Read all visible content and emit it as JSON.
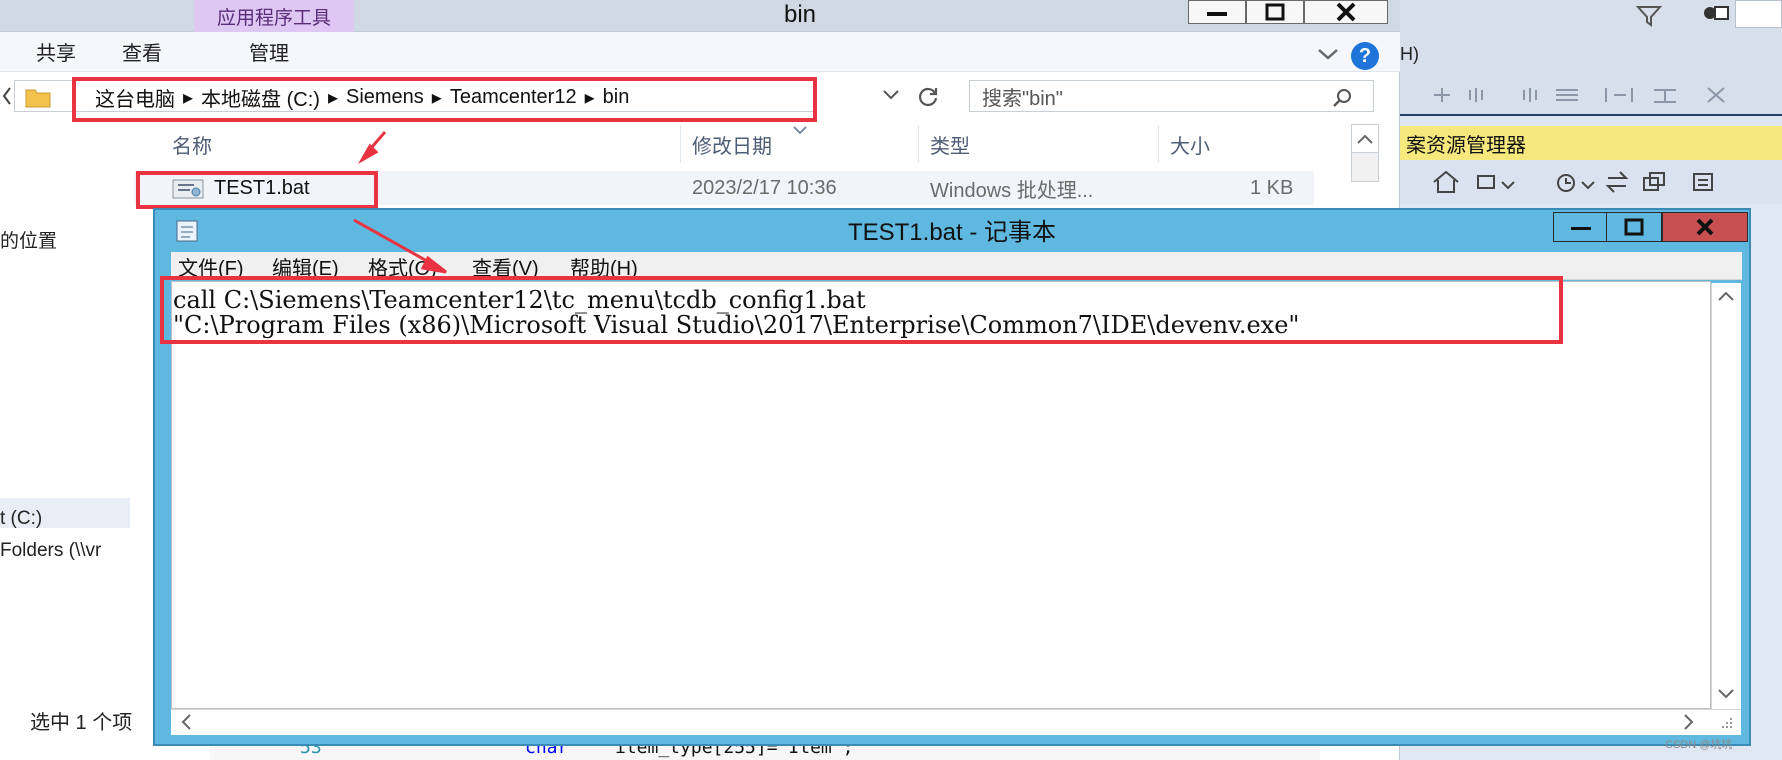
{
  "explorer": {
    "title": "bin",
    "context_tab": "应用程序工具",
    "menu": [
      "共享",
      "查看",
      "管理"
    ],
    "breadcrumb": [
      "这台电脑",
      "本地磁盘 (C:)",
      "Siemens",
      "Teamcenter12",
      "bin"
    ],
    "search_placeholder": "搜索\"bin\"",
    "columns": [
      "名称",
      "修改日期",
      "类型",
      "大小"
    ],
    "file": {
      "name": "TEST1.bat",
      "date": "2023/2/17 10:36",
      "type": "Windows 批处理...",
      "size": "1 KB"
    },
    "left_nav": [
      "的位置",
      "t (C:)",
      "Folders (\\\\vr"
    ],
    "status": "选中 1 个项"
  },
  "ide": {
    "menu_fragment": "H)",
    "panel_title": "案资源管理器"
  },
  "notepad": {
    "title": "TEST1.bat - 记事本",
    "menu": [
      "文件(F)",
      "编辑(E)",
      "格式(O)",
      "查看(V)",
      "帮助(H)"
    ],
    "lines": [
      "call C:\\Siemens\\Teamcenter12\\tc_menu\\tcdb_config1.bat",
      "\"C:\\Program Files (x86)\\Microsoft Visual Studio\\2017\\Enterprise\\Common7\\IDE\\devenv.exe\""
    ]
  },
  "code_peek": {
    "line_no": "53",
    "keyword": "char",
    "code": "item_type[255]= Item ;"
  },
  "watermark": "CSDN @坑坑"
}
